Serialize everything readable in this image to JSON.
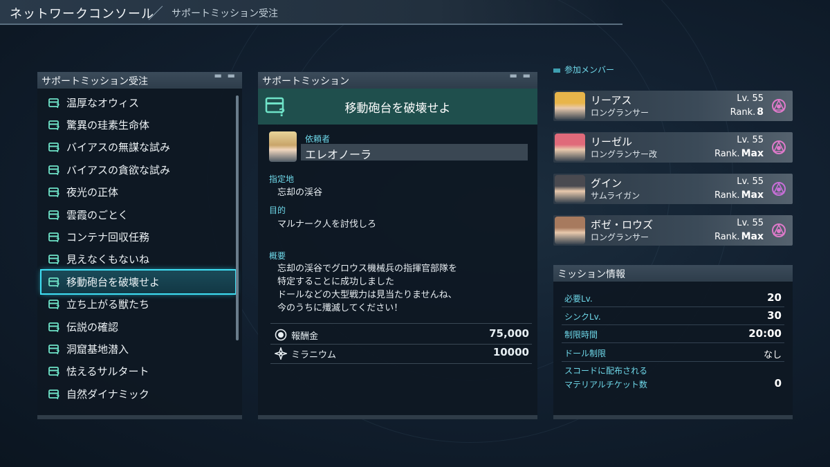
{
  "header": {
    "title": "ネットワークコンソール",
    "breadcrumb": "サポートミッション受注"
  },
  "list_panel": {
    "title": "サポートミッション受注",
    "items": [
      {
        "label": "温厚なオウィス"
      },
      {
        "label": "驚異の珪素生命体"
      },
      {
        "label": "バイアスの無謀な試み"
      },
      {
        "label": "バイアスの貪欲な試み"
      },
      {
        "label": "夜光の正体"
      },
      {
        "label": "雲霞のごとく"
      },
      {
        "label": "コンテナ回収任務"
      },
      {
        "label": "見えなくもないね"
      },
      {
        "label": "移動砲台を破壊せよ"
      },
      {
        "label": "立ち上がる獣たち"
      },
      {
        "label": "伝説の確認"
      },
      {
        "label": "洞窟基地潜入"
      },
      {
        "label": "怯えるサルタート"
      },
      {
        "label": "自然ダイナミック"
      }
    ],
    "selected_index": 8
  },
  "detail": {
    "panel_title": "サポートミッション",
    "mission_title": "移動砲台を破壊せよ",
    "client_label": "依頼者",
    "client_name": "エレオノーラ",
    "location_label": "指定地",
    "location": "忘却の渓谷",
    "objective_label": "目的",
    "objective": "マルナーク人を討伐しろ",
    "summary_label": "概要",
    "summary_lines": [
      "忘却の渓谷でグロウス機械兵の指揮官部隊を",
      "特定することに成功しました",
      "ドールなどの大型戦力は見当たりませんね、",
      "今のうちに殲滅してください！"
    ],
    "rewards": [
      {
        "label": "報酬金",
        "value": "75,000",
        "icon": "reward-coin-icon"
      },
      {
        "label": "ミラニウム",
        "value": "10000",
        "icon": "miranium-icon"
      }
    ]
  },
  "members": {
    "label": "参加メンバー",
    "list": [
      {
        "name": "リーアス",
        "class": "ロングランサー",
        "level": "Lv. 55",
        "rank_prefix": "Rank.",
        "rank": "8",
        "portrait_color": "#e8b54a",
        "emblem_color": "#e07acb"
      },
      {
        "name": "リーゼル",
        "class": "ロングランサー改",
        "level": "Lv. 55",
        "rank_prefix": "Rank.",
        "rank": "Max",
        "portrait_color": "#e06a7a",
        "emblem_color": "#e07acb"
      },
      {
        "name": "グイン",
        "class": "サムライガン",
        "level": "Lv. 55",
        "rank_prefix": "Rank.",
        "rank": "Max",
        "portrait_color": "#4a4a50",
        "emblem_color": "#c86fd8"
      },
      {
        "name": "ボゼ・ロウズ",
        "class": "ロングランサー",
        "level": "Lv. 55",
        "rank_prefix": "Rank.",
        "rank": "Max",
        "portrait_color": "#a77a5e",
        "emblem_color": "#e07acb"
      }
    ]
  },
  "mission_info": {
    "title": "ミッション情報",
    "rows": [
      {
        "label": "必要Lv.",
        "value": "20"
      },
      {
        "label": "シンクLv.",
        "value": "30"
      },
      {
        "label": "制限時間",
        "value": "20:00"
      },
      {
        "label": "ドール制限",
        "value": "なし"
      }
    ],
    "ticket_label_1": "スコードに配布される",
    "ticket_label_2": "マテリアルチケット数",
    "ticket_value": "0"
  },
  "colors": {
    "accent": "#3fe0f5",
    "label": "#6fd9ea",
    "title_bar": "#1f4f4d"
  }
}
